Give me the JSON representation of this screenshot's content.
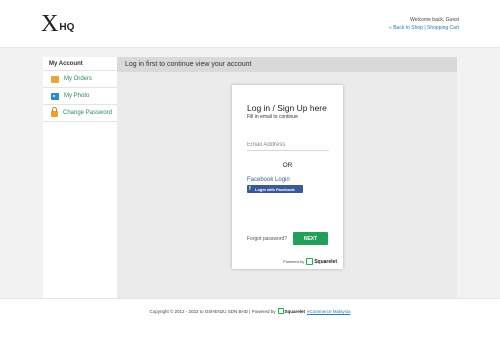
{
  "header": {
    "logo_x": "X",
    "logo_hq": "HQ",
    "welcome": "Welcome back, Guest",
    "back_to_shop": "« Back to Shop",
    "separator": " | ",
    "shopping_cart": "Shopping Cart"
  },
  "sidebar": {
    "title": "My Account",
    "items": [
      {
        "label": "My Orders",
        "icon": "orders-icon"
      },
      {
        "label": "My Photo",
        "icon": "photo-icon"
      },
      {
        "label": "Change Password",
        "icon": "lock-icon"
      }
    ]
  },
  "main": {
    "notice": "Log in first to continue view your account"
  },
  "login_card": {
    "title": "Log in / Sign Up here",
    "subtitle": "Fill in email to continue",
    "email_placeholder": "Email Address",
    "or_text": "OR",
    "facebook_label": "Facebook Login",
    "facebook_button": "Login with Facebook",
    "forgot_password": "Forgot password?",
    "next_button": "NEXT",
    "powered_by": "Powered by",
    "brand": "Squarelet"
  },
  "footer": {
    "copyright": "Copyright © 2012 - 2022 to OSHEN2U SDN BHD | Powered by",
    "brand": "Squarelet",
    "link_text": "eCommerce Malaysia"
  },
  "colors": {
    "accent_green": "#22a05b",
    "link_blue": "#2a7ab8",
    "facebook_blue": "#3b5998",
    "sidebar_text": "#2e8b57"
  }
}
